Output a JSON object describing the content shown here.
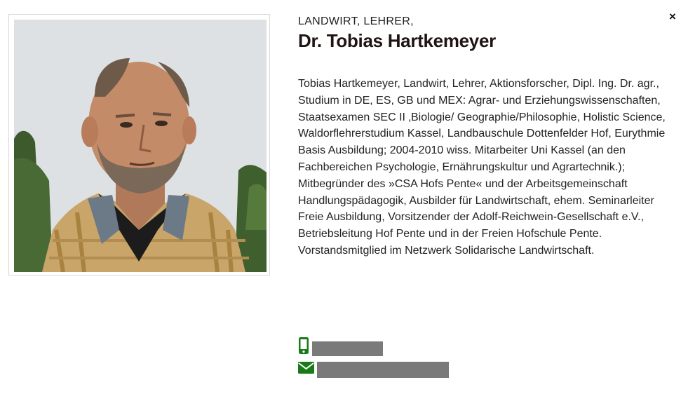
{
  "modal": {
    "close_label": "×",
    "kicker": "LANDWIRT, LEHRER,",
    "name": "Dr. Tobias Hartkemeyer",
    "bio": "Tobias Hartkemeyer, Landwirt, Lehrer, Aktionsforscher, Dipl. Ing. Dr. agr., Studium in DE, ES, GB und MEX: Agrar- und Erziehungswissenschaften, Staatsexamen SEC II ‚Biologie/ Geographie/Philosophie, Holistic Science, Waldorflehrerstudium Kassel, Landbauschule Dottenfelder Hof, Eurythmie Basis Ausbildung; 2004-2010 wiss. Mitarbeiter Uni Kassel (an den Fachbereichen Psychologie, Ernährungskultur und Agrartechnik.); Mitbegründer des »CSA Hofs Pente« und der Arbeitsgemeinschaft Handlungspädagogik, Ausbilder für Landwirtschaft, ehem. Seminarleiter Freie Ausbildung, Vorsitzender der Adolf-Reichwein-Gesellschaft e.V., Betriebsleitung Hof Pente und in der Freien Hofschule Pente. Vorstandsmitglied im Netzwerk Solidarische Landwirtschaft."
  },
  "contact": {
    "phone_icon": "mobile-phone-icon",
    "mail_icon": "envelope-icon",
    "phone_value": "",
    "email_value": ""
  },
  "colors": {
    "icon_green": "#1a7a1a",
    "redaction_gray": "#7a7a7a",
    "name_color": "#1f1413"
  }
}
